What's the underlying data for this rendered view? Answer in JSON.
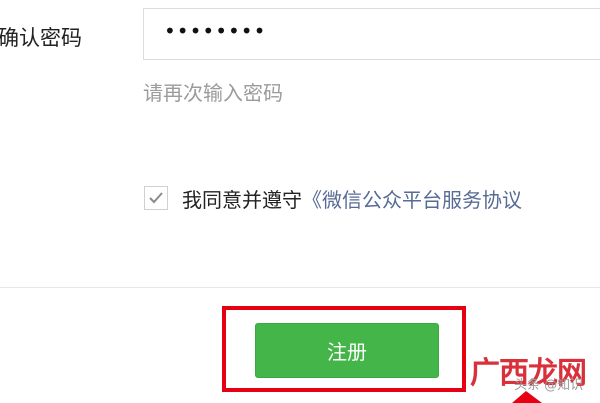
{
  "form": {
    "confirm_password_label": "确认密码",
    "confirm_password_value": "••••••••",
    "confirm_password_hint": "请再次输入密码",
    "agreement_checked": true,
    "agreement_text": "我同意并遵守",
    "agreement_link": "《微信公众平台服务协议"
  },
  "register_button_label": "注册",
  "watermark": {
    "logo_text": "广西龙网",
    "sub_text": "头条 @知识"
  },
  "colors": {
    "button": "#44b549",
    "link": "#576b95",
    "highlight": "#e60012",
    "hint": "#9b9b9b"
  }
}
